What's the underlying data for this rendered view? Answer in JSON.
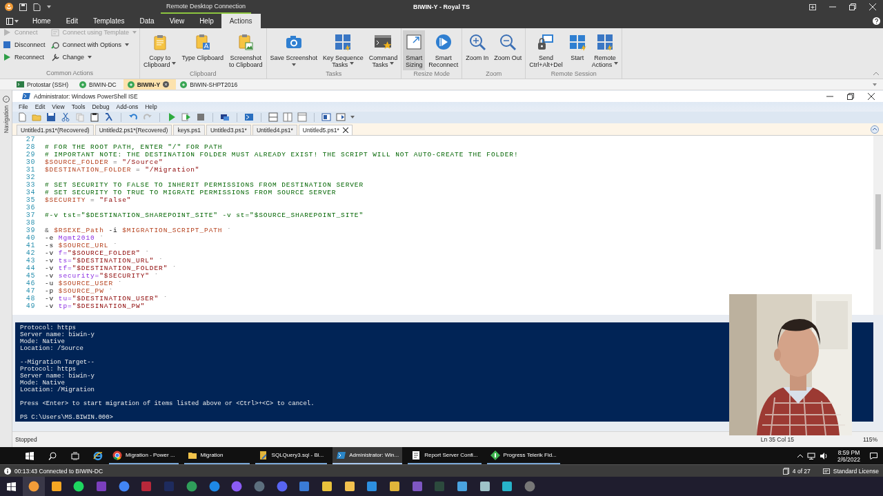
{
  "window": {
    "title": "BIWIN-Y - Royal TS",
    "context_title": "Remote Desktop Connection"
  },
  "ribbon": {
    "tabs": [
      {
        "label": "Home",
        "selected": false
      },
      {
        "label": "Edit",
        "selected": false
      },
      {
        "label": "Templates",
        "selected": false
      },
      {
        "label": "Data",
        "selected": false
      },
      {
        "label": "View",
        "selected": false
      },
      {
        "label": "Help",
        "selected": false
      },
      {
        "label": "Actions",
        "selected": true
      }
    ],
    "groups": [
      {
        "title": "Common Actions",
        "kind": "small",
        "items": [
          {
            "label": "Connect",
            "disabled": true,
            "dropdown": false
          },
          {
            "label": "Disconnect",
            "disabled": false,
            "dropdown": false
          },
          {
            "label": "Reconnect",
            "disabled": false,
            "dropdown": false
          },
          {
            "label": "Connect using Template",
            "disabled": true,
            "dropdown": true
          },
          {
            "label": "Connect with Options",
            "disabled": false,
            "dropdown": true
          },
          {
            "label": "Change",
            "disabled": false,
            "dropdown": true
          }
        ]
      },
      {
        "title": "Clipboard",
        "kind": "large",
        "items": [
          {
            "label": "Copy to\nClipboard",
            "dropdown": true,
            "on": false
          },
          {
            "label": "Type Clipboard",
            "dropdown": false,
            "on": false
          },
          {
            "label": "Screenshot\nto Clipboard",
            "dropdown": false,
            "on": false
          }
        ]
      },
      {
        "title": "Tasks",
        "kind": "large",
        "items": [
          {
            "label": "Save Screenshot",
            "dropdown": true,
            "on": false
          },
          {
            "label": "Key Sequence\nTasks",
            "dropdown": true,
            "on": false
          },
          {
            "label": "Command\nTasks",
            "dropdown": true,
            "on": false
          }
        ]
      },
      {
        "title": "Resize Mode",
        "kind": "large",
        "items": [
          {
            "label": "Smart\nSizing",
            "dropdown": false,
            "on": true
          },
          {
            "label": "Smart\nReconnect",
            "dropdown": false,
            "on": false
          }
        ]
      },
      {
        "title": "Zoom",
        "kind": "large",
        "items": [
          {
            "label": "Zoom In",
            "dropdown": false,
            "on": false
          },
          {
            "label": "Zoom Out",
            "dropdown": false,
            "on": false
          }
        ]
      },
      {
        "title": "Remote Session",
        "kind": "large",
        "items": [
          {
            "label": "Send\nCtrl+Alt+Del",
            "dropdown": false,
            "on": false
          },
          {
            "label": "Start",
            "dropdown": false,
            "on": false
          },
          {
            "label": "Remote\nActions",
            "dropdown": true,
            "on": false
          }
        ]
      }
    ]
  },
  "session_tabs": [
    {
      "label": "Protostar (SSH)",
      "kind": "ssh",
      "selected": false
    },
    {
      "label": "BIWIN-DC",
      "kind": "rdp",
      "selected": false
    },
    {
      "label": "BIWIN-Y",
      "kind": "rdp",
      "selected": true
    },
    {
      "label": "BIWIN-SHPT2016",
      "kind": "rdp",
      "selected": false
    }
  ],
  "navigation": {
    "label": "Navigation"
  },
  "ise": {
    "title": "Administrator: Windows PowerShell ISE",
    "menu": [
      "File",
      "Edit",
      "View",
      "Tools",
      "Debug",
      "Add-ons",
      "Help"
    ],
    "script_tabs": [
      {
        "label": "Untitled1.ps1*(Recovered)",
        "selected": false
      },
      {
        "label": "Untitled2.ps1*(Recovered)",
        "selected": false
      },
      {
        "label": "keys.ps1",
        "selected": false
      },
      {
        "label": "Untitled3.ps1*",
        "selected": false
      },
      {
        "label": "Untitled4.ps1*",
        "selected": false
      },
      {
        "label": "Untitled5.ps1*",
        "selected": true
      }
    ],
    "code": [
      {
        "number": "27"
      },
      {
        "number": "28",
        "segments": [
          {
            "kind": "comment",
            "text": "# FOR THE ROOT PATH, ENTER \"/\" FOR PATH"
          }
        ]
      },
      {
        "number": "29",
        "segments": [
          {
            "kind": "comment",
            "text": "# IMPORTANT NOTE: THE DESTINATION FOLDER MUST ALREADY EXIST! THE SCRIPT WILL NOT AUTO-CREATE THE FOLDER!"
          }
        ]
      },
      {
        "number": "30",
        "segments": [
          {
            "kind": "variable",
            "text": "$SOURCE_FOLDER"
          },
          {
            "kind": "operator",
            "text": " = "
          },
          {
            "kind": "string",
            "text": "\"/Source\""
          }
        ]
      },
      {
        "number": "31",
        "segments": [
          {
            "kind": "variable",
            "text": "$DESTINATION_FOLDER"
          },
          {
            "kind": "operator",
            "text": " = "
          },
          {
            "kind": "string",
            "text": "\"/Migration\""
          }
        ]
      },
      {
        "number": "32"
      },
      {
        "number": "33",
        "segments": [
          {
            "kind": "comment",
            "text": "# SET SECURITY TO FALSE TO INHERIT PERMISSIONS FROM DESTINATION SERVER"
          }
        ]
      },
      {
        "number": "34",
        "segments": [
          {
            "kind": "comment",
            "text": "# SET SECURITY TO TRUE TO MIGRATE PERMISSIONS FROM SOURCE SERVER"
          }
        ]
      },
      {
        "number": "35",
        "segments": [
          {
            "kind": "variable",
            "text": "$SECURITY"
          },
          {
            "kind": "operator",
            "text": " = "
          },
          {
            "kind": "string",
            "text": "\"False\""
          }
        ]
      },
      {
        "number": "36"
      },
      {
        "number": "37",
        "segments": [
          {
            "kind": "comment",
            "text": "#-v tst=\"$DESTINATION_SHAREPOINT_SITE\" -v st=\"$SOURCE_SHAREPOINT_SITE\""
          }
        ]
      },
      {
        "number": "38"
      },
      {
        "number": "39",
        "segments": [
          {
            "kind": "operator",
            "text": "& "
          },
          {
            "kind": "variable",
            "text": "$RSEXE_Path"
          },
          {
            "kind": "param",
            "text": " -i "
          },
          {
            "kind": "variable",
            "text": "$MIGRATION_SCRIPT_PATH"
          },
          {
            "kind": "operator",
            "text": " `"
          }
        ]
      },
      {
        "number": "40",
        "segments": [
          {
            "kind": "param",
            "text": "-e "
          },
          {
            "kind": "argument",
            "text": "Mgmt2010"
          },
          {
            "kind": "operator",
            "text": " `"
          }
        ]
      },
      {
        "number": "41",
        "segments": [
          {
            "kind": "param",
            "text": "-s "
          },
          {
            "kind": "variable",
            "text": "$SOURCE_URL"
          },
          {
            "kind": "operator",
            "text": " `"
          }
        ]
      },
      {
        "number": "42",
        "segments": [
          {
            "kind": "param",
            "text": "-v "
          },
          {
            "kind": "argument",
            "text": "f="
          },
          {
            "kind": "string",
            "text": "\"$SOURCE_FOLDER\""
          },
          {
            "kind": "operator",
            "text": " `"
          }
        ]
      },
      {
        "number": "43",
        "segments": [
          {
            "kind": "param",
            "text": "-v "
          },
          {
            "kind": "argument",
            "text": "ts="
          },
          {
            "kind": "string",
            "text": "\"$DESTINATION_URL\""
          },
          {
            "kind": "operator",
            "text": " `"
          }
        ]
      },
      {
        "number": "44",
        "segments": [
          {
            "kind": "param",
            "text": "-v "
          },
          {
            "kind": "argument",
            "text": "tf="
          },
          {
            "kind": "string",
            "text": "\"$DESTINATION_FOLDER\""
          },
          {
            "kind": "operator",
            "text": " `"
          }
        ]
      },
      {
        "number": "45",
        "segments": [
          {
            "kind": "param",
            "text": "-v "
          },
          {
            "kind": "argument",
            "text": "security="
          },
          {
            "kind": "string",
            "text": "\"$SECURITY\""
          },
          {
            "kind": "operator",
            "text": " `"
          }
        ]
      },
      {
        "number": "46",
        "segments": [
          {
            "kind": "param",
            "text": "-u "
          },
          {
            "kind": "variable",
            "text": "$SOURCE_USER"
          },
          {
            "kind": "operator",
            "text": " `"
          }
        ]
      },
      {
        "number": "47",
        "segments": [
          {
            "kind": "param",
            "text": "-p "
          },
          {
            "kind": "variable",
            "text": "$SOURCE_PW"
          },
          {
            "kind": "operator",
            "text": " `"
          }
        ]
      },
      {
        "number": "48",
        "segments": [
          {
            "kind": "param",
            "text": "-v "
          },
          {
            "kind": "argument",
            "text": "tu="
          },
          {
            "kind": "string",
            "text": "\"$DESTINATION_USER\""
          },
          {
            "kind": "operator",
            "text": " `"
          }
        ]
      },
      {
        "number": "49",
        "segments": [
          {
            "kind": "param",
            "text": "-v "
          },
          {
            "kind": "argument",
            "text": "tp="
          },
          {
            "kind": "string",
            "text": "\"$DESINATION_PW\""
          }
        ]
      }
    ],
    "console": {
      "blocks": [
        [
          "Protocol: https",
          "Server name: biwin-y",
          "Mode: Native",
          "Location: /Source"
        ],
        [
          "--Migration Target--",
          "Protocol: https",
          "Server name: biwin-y",
          "Mode: Native",
          "Location: /Migration"
        ],
        [
          "Press <Enter> to start migration of items listed above or <Ctrl>+<C> to cancel."
        ],
        [
          "PS C:\\Users\\MS.BIWIN.000>"
        ]
      ]
    },
    "status": "Stopped",
    "cursor": "Ln 35 Col 15",
    "zoom": "115%"
  },
  "remote_taskbar": {
    "items": [
      {
        "label": "Migration - Power ...",
        "kind": "chrome",
        "selected": false
      },
      {
        "label": "Migration",
        "kind": "folder",
        "selected": false
      },
      {
        "label": "SQLQuery3.sql - Bl...",
        "kind": "sql",
        "selected": false
      },
      {
        "label": "Administrator: Win...",
        "kind": "powershell",
        "selected": true
      },
      {
        "label": "Report Server Confi...",
        "kind": "report",
        "selected": false
      },
      {
        "label": "Progress Telerik Fid...",
        "kind": "fiddler",
        "selected": false
      }
    ],
    "time": "8:59 PM",
    "date": "2/6/2022"
  },
  "status_bar": {
    "session": "00:13:43 Connected to BIWIN-DC",
    "page": "4 of 27",
    "license": "Standard License"
  }
}
